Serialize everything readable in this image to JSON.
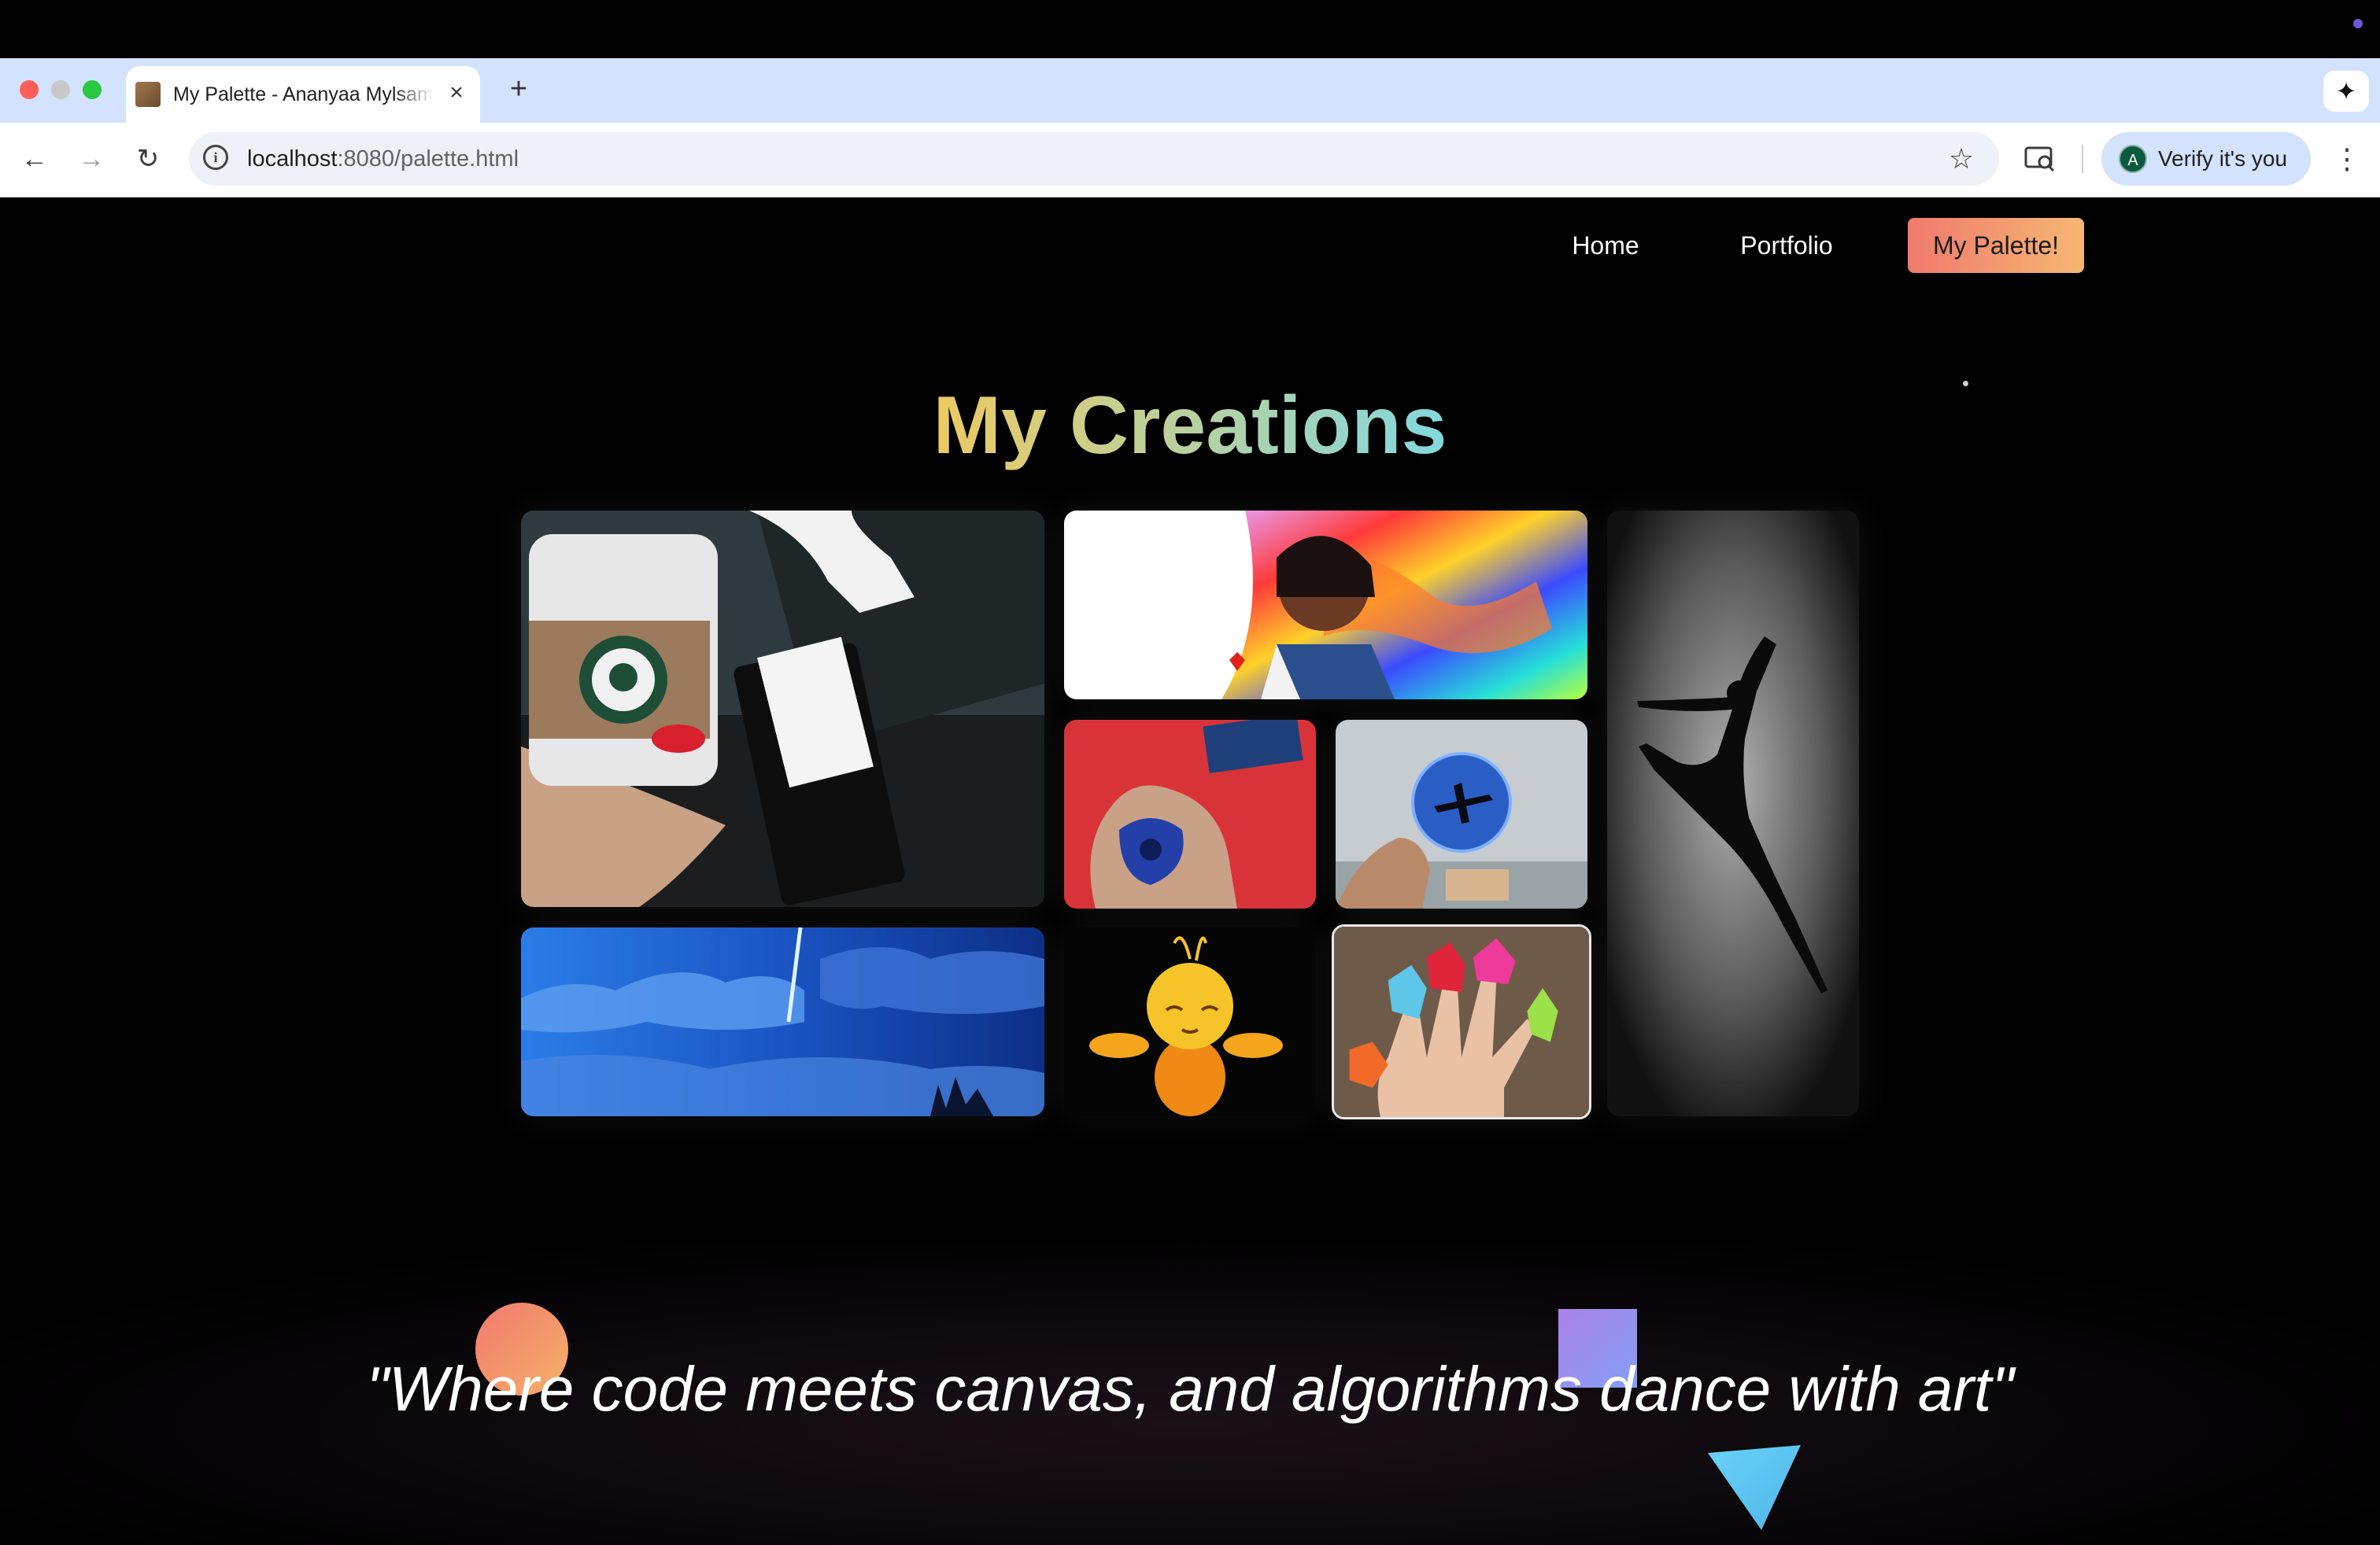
{
  "browser": {
    "tab_title": "My Palette - Ananyaa Mylsamy",
    "tab_close": "×",
    "new_tab": "+",
    "url_host": "localhost",
    "url_rest": ":8080/palette.html",
    "profile_initial": "A",
    "profile_label": "Verify it's you",
    "icons": [
      "back-arrow-icon",
      "forward-arrow-icon",
      "reload-icon",
      "info-icon",
      "star-icon",
      "cast-search-icon",
      "kebab-menu-icon",
      "gemini-sparkle-icon"
    ]
  },
  "nav": {
    "home": "Home",
    "portfolio": "Portfolio",
    "palette": "My Palette!"
  },
  "main": {
    "title": "My Creations",
    "gallery": [
      {
        "name": "coffee-passport-artwork"
      },
      {
        "name": "girl-colorful-swirls-artwork"
      },
      {
        "name": "painted-hand-artwork"
      },
      {
        "name": "airplane-coaster-artwork"
      },
      {
        "name": "dancer-silhouette-artwork"
      },
      {
        "name": "night-sky-comet-artwork"
      },
      {
        "name": "cute-bee-artwork"
      },
      {
        "name": "origami-finger-bunnies-artwork"
      }
    ]
  },
  "footer": {
    "quote": "\"Where code meets canvas, and algorithms dance with art\""
  },
  "colors": {
    "accent_gradient_start": "#f07a6e",
    "accent_gradient_end": "#f6b772",
    "title_gradient_start": "#f2c95b",
    "title_gradient_end": "#7dd9e6"
  }
}
